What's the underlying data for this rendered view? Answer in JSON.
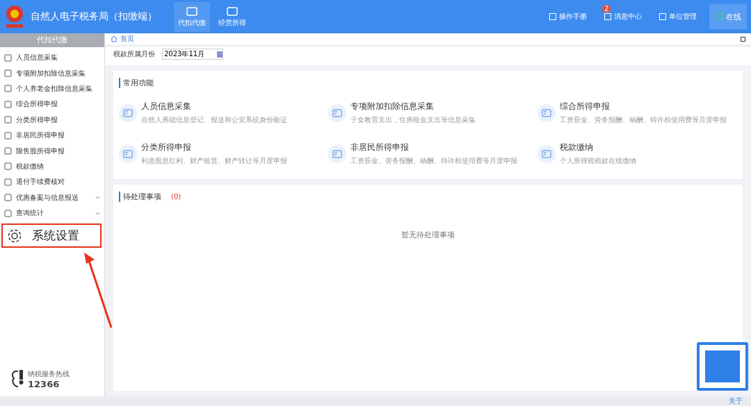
{
  "header": {
    "title": "自然人电子税务局（扣缴端）",
    "nav": [
      {
        "label": "代扣代缴",
        "selected": true
      },
      {
        "label": "经营所得",
        "selected": false
      }
    ],
    "actions": [
      {
        "label": "操作手册"
      },
      {
        "label": "消息中心",
        "badge": "2"
      },
      {
        "label": "单位管理"
      }
    ],
    "online": {
      "label": "在线"
    }
  },
  "sidebar": {
    "title": "代扣代缴",
    "items": [
      {
        "label": "人员信息采集",
        "has_submenu": false
      },
      {
        "label": "专项附加扣除信息采集",
        "has_submenu": false
      },
      {
        "label": "个人养老金扣除信息采集",
        "has_submenu": false
      },
      {
        "label": "综合所得申报",
        "has_submenu": false
      },
      {
        "label": "分类所得申报",
        "has_submenu": false
      },
      {
        "label": "非居民所得申报",
        "has_submenu": false
      },
      {
        "label": "限售股所得申报",
        "has_submenu": false
      },
      {
        "label": "税款缴纳",
        "has_submenu": false
      },
      {
        "label": "退付手续费核对",
        "has_submenu": false
      },
      {
        "label": "优惠备案与信息报送",
        "has_submenu": true
      },
      {
        "label": "查询统计",
        "has_submenu": true
      }
    ],
    "highlight": {
      "label": "系统设置"
    },
    "hotline": {
      "caption": "纳税服务热线",
      "number": "12366"
    }
  },
  "breadcrumb": "首页",
  "tax_month": {
    "label": "税款所属月份",
    "value": "2023年11月"
  },
  "common": {
    "title": "常用功能",
    "items": [
      {
        "title": "人员信息采集",
        "desc": "自然人基础信息登记、报送和公安系统身份验证"
      },
      {
        "title": "专项附加扣除信息采集",
        "desc": "子女教育支出，住房租金支出等信息采集"
      },
      {
        "title": "综合所得申报",
        "desc": "工资薪金、劳务报酬、稿酬、特许权使用费等月度申报"
      },
      {
        "title": "分类所得申报",
        "desc": "利息股息红利、财产租赁、财产转让等月度申报"
      },
      {
        "title": "非居民所得申报",
        "desc": "工资薪金、劳务报酬、稿酬、特许权使用费等月度申报"
      },
      {
        "title": "税款缴纳",
        "desc": "个人所得税税款在线缴纳"
      }
    ]
  },
  "pending": {
    "title": "待处理事项",
    "count": "(0)",
    "empty": "暂无待处理事项"
  },
  "status_bar": {
    "about": "关于"
  }
}
